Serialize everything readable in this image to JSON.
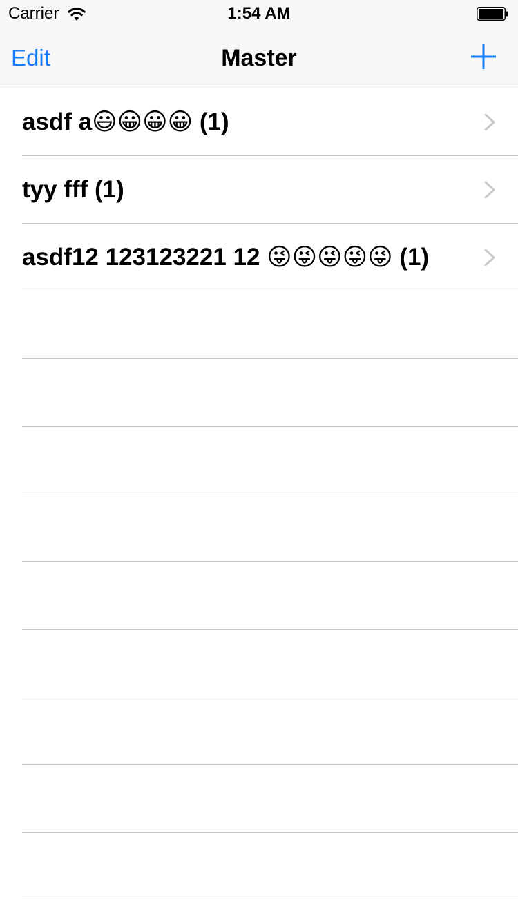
{
  "status_bar": {
    "carrier": "Carrier",
    "time": "1:54 AM",
    "icons": [
      "wifi-icon",
      "battery-icon"
    ]
  },
  "nav_bar": {
    "left_button_label": "Edit",
    "title": "Master",
    "right_button_icon": "plus-icon"
  },
  "list": {
    "items": [
      {
        "label": "asdf a😃😀😀😀 (1)",
        "accessory_icon": "chevron-right-icon"
      },
      {
        "label": "tyy fff (1)",
        "accessory_icon": "chevron-right-icon"
      },
      {
        "label": "asdf12 123123221 12 😜😜😜😜😜 (1)",
        "accessory_icon": "chevron-right-icon"
      }
    ]
  },
  "colors": {
    "tint": "#157efb",
    "nav_background": "#f7f7f7",
    "separator": "#c8c7cc",
    "chevron": "#c7c7cc"
  }
}
